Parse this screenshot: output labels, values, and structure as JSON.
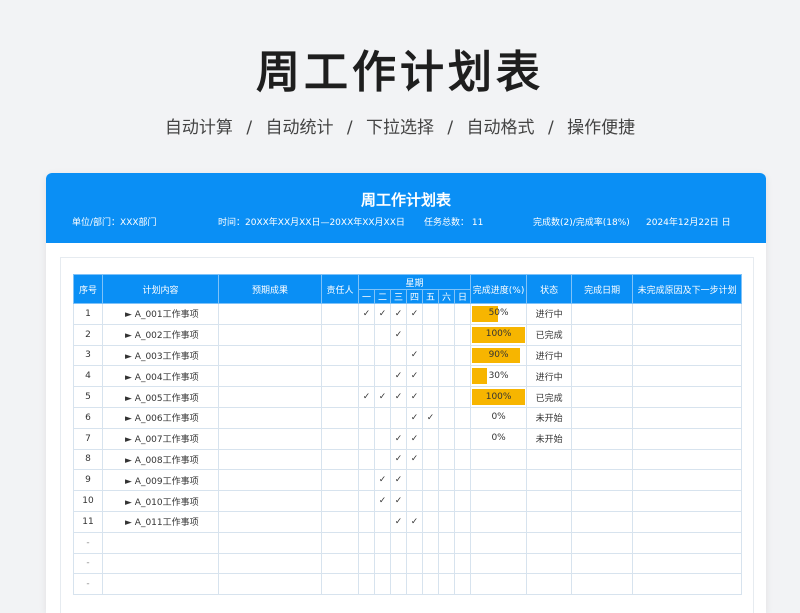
{
  "hero": {
    "title": "周工作计划表",
    "features": [
      "自动计算",
      "/",
      "自动统计",
      "/",
      "下拉选择",
      "/",
      "自动格式",
      "/",
      "操作便捷"
    ]
  },
  "header": {
    "title": "周工作计划表",
    "unit": "单位/部门：XXX部门",
    "time": "时间：20XX年XX月XX日—20XX年XX月XX日",
    "task_total": "任务总数：  11",
    "completion": "完成数(2)/完成率(18%)",
    "date": "2024年12月22日  日"
  },
  "table": {
    "headers": {
      "index": "序号",
      "content": "计划内容",
      "expected": "预期成果",
      "owner": "责任人",
      "week": "星期",
      "progress": "完成进度(%)",
      "status": "状态",
      "done_date": "完成日期",
      "reason": "未完成原因及下一步计划"
    },
    "days": [
      "一",
      "二",
      "三",
      "四",
      "五",
      "六",
      "日"
    ],
    "rows": [
      {
        "index": "1",
        "content": "► A_001工作事项",
        "checks": [
          "✓",
          "✓",
          "✓",
          "✓",
          "",
          "",
          ""
        ],
        "progress": 0.5,
        "progress_label": "50%",
        "status": "进行中"
      },
      {
        "index": "2",
        "content": "► A_002工作事项",
        "checks": [
          "",
          "",
          "✓",
          "",
          "",
          "",
          ""
        ],
        "progress": 1.0,
        "progress_label": "100%",
        "status": "已完成"
      },
      {
        "index": "3",
        "content": "► A_003工作事项",
        "checks": [
          "",
          "",
          "",
          "✓",
          "",
          "",
          ""
        ],
        "progress": 0.9,
        "progress_label": "90%",
        "status": "进行中"
      },
      {
        "index": "4",
        "content": "► A_004工作事项",
        "checks": [
          "",
          "",
          "✓",
          "✓",
          "",
          "",
          ""
        ],
        "progress": 0.3,
        "progress_label": "30%",
        "status": "进行中"
      },
      {
        "index": "5",
        "content": "► A_005工作事项",
        "checks": [
          "✓",
          "✓",
          "✓",
          "✓",
          "",
          "",
          ""
        ],
        "progress": 1.0,
        "progress_label": "100%",
        "status": "已完成"
      },
      {
        "index": "6",
        "content": "► A_006工作事项",
        "checks": [
          "",
          "",
          "",
          "✓",
          "✓",
          "",
          ""
        ],
        "progress": 0,
        "progress_label": "0%",
        "status": "未开始"
      },
      {
        "index": "7",
        "content": "► A_007工作事项",
        "checks": [
          "",
          "",
          "✓",
          "✓",
          "",
          "",
          ""
        ],
        "progress": 0,
        "progress_label": "0%",
        "status": "未开始"
      },
      {
        "index": "8",
        "content": "► A_008工作事项",
        "checks": [
          "",
          "",
          "✓",
          "✓",
          "",
          "",
          ""
        ],
        "progress": null,
        "progress_label": "",
        "status": ""
      },
      {
        "index": "9",
        "content": "► A_009工作事项",
        "checks": [
          "",
          "✓",
          "✓",
          "",
          "",
          "",
          ""
        ],
        "progress": null,
        "progress_label": "",
        "status": ""
      },
      {
        "index": "10",
        "content": "► A_010工作事项",
        "checks": [
          "",
          "✓",
          "✓",
          "",
          "",
          "",
          ""
        ],
        "progress": null,
        "progress_label": "",
        "status": ""
      },
      {
        "index": "11",
        "content": "► A_011工作事项",
        "checks": [
          "",
          "",
          "✓",
          "✓",
          "",
          "",
          ""
        ],
        "progress": null,
        "progress_label": "",
        "status": ""
      },
      {
        "index": "-",
        "content": "",
        "checks": [
          "",
          "",
          "",
          "",
          "",
          "",
          ""
        ],
        "progress": null,
        "progress_label": "",
        "status": ""
      },
      {
        "index": "-",
        "content": "",
        "checks": [
          "",
          "",
          "",
          "",
          "",
          "",
          ""
        ],
        "progress": null,
        "progress_label": "",
        "status": ""
      },
      {
        "index": "-",
        "content": "",
        "checks": [
          "",
          "",
          "",
          "",
          "",
          "",
          ""
        ],
        "progress": null,
        "progress_label": "",
        "status": ""
      }
    ]
  },
  "colors": {
    "accent": "#0a8ff5",
    "progress_bar": "#f7b500"
  }
}
